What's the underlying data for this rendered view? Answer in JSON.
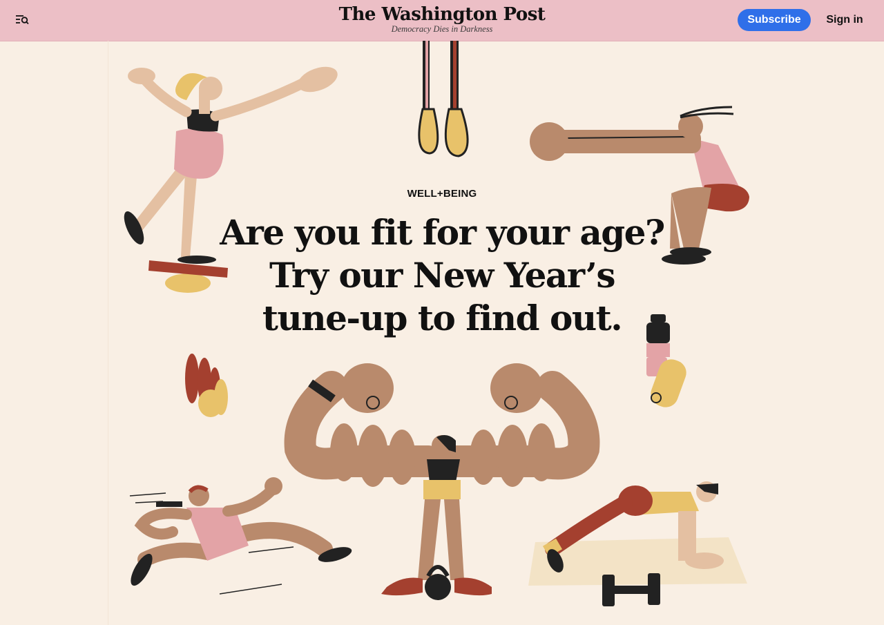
{
  "header": {
    "menu_icon": "menu-search-icon",
    "logo": "The Washington Post",
    "tagline": "Democracy Dies in Darkness",
    "subscribe_label": "Subscribe",
    "signin_label": "Sign in"
  },
  "article": {
    "kicker": "WELL+BEING",
    "headline_lines": [
      "Are you fit for your age?",
      "Try our New Year’s",
      "tune-up to find out."
    ]
  },
  "colors": {
    "header_bg": "#ecbfc6",
    "page_bg": "#f9efe4",
    "subscribe_bg": "#2f6fe9",
    "skin_light": "#e4c0a2",
    "skin_dark": "#b98a6c",
    "pink": "#e3a3a6",
    "rust": "#a4402f",
    "mustard": "#e8c26a",
    "ink": "#222222"
  }
}
